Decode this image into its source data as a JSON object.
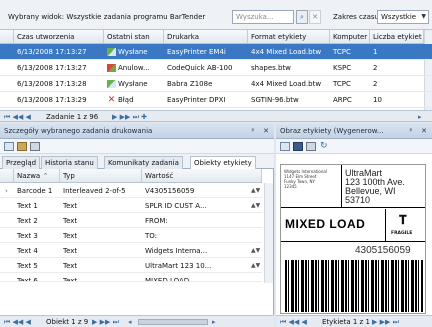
{
  "filter": {
    "label": "Wybrany widok: Wszystkie zadania programu BarTender",
    "search_placeholder": "Wyszuka...",
    "zakres_label": "Zakres czasu:",
    "zakres_value": "Wszystkie"
  },
  "jobs": {
    "columns": [
      "Czas utworzenia",
      "Ostatni stan",
      "Drukarka",
      "Format etykiety",
      "Komputer",
      "Liczba etykiet"
    ],
    "rows": [
      {
        "time": "6/13/2008 17:13:27",
        "status": "Wysłane",
        "status_icon": "sent-icon",
        "printer": "EasyPrinter EM4i",
        "format": "4x4 Mixed Load.btw",
        "computer": "TCPC",
        "count": "1",
        "selected": true
      },
      {
        "time": "6/13/2008 17:13:27",
        "status": "Anulow...",
        "status_icon": "cancel-icon",
        "printer": "CodeQuick AB-100",
        "format": "shapes.btw",
        "computer": "KSPC",
        "count": "2",
        "selected": false
      },
      {
        "time": "6/13/2008 17:13:28",
        "status": "Wysłane",
        "status_icon": "sent-icon",
        "printer": "Babra Z108e",
        "format": "4x4 Mixed Load.btw",
        "computer": "TCPC",
        "count": "2",
        "selected": false
      },
      {
        "time": "6/13/2008 17:13:29",
        "status": "Błąd",
        "status_icon": "error-icon",
        "printer": "EasyPrinter DPXI",
        "format": "SGTIN-96.btw",
        "computer": "ARPC",
        "count": "10",
        "selected": false
      }
    ],
    "pager": {
      "text": "Zadanie 1 z 96"
    }
  },
  "details": {
    "title": "Szczegóły wybranego zadania drukowania",
    "tabs": [
      "Przegląd",
      "Historia stanu",
      "Komunikaty zadania",
      "Obiekty etykiety"
    ],
    "columns": [
      "Nazwa",
      "Typ",
      "Wartość"
    ],
    "rows": [
      {
        "name": "Barcode 1",
        "type": "Interleaved 2-of-5",
        "value": "V4305156059"
      },
      {
        "name": "Text 1",
        "type": "Text",
        "value": "SPLR ID CUST A..."
      },
      {
        "name": "Text 2",
        "type": "Text",
        "value": "FROM:"
      },
      {
        "name": "Text 3",
        "type": "Text",
        "value": "TO:"
      },
      {
        "name": "Text 4",
        "type": "Text",
        "value": "Widgets Interna..."
      },
      {
        "name": "Text 5",
        "type": "Text",
        "value": "UltraMart 123 10..."
      },
      {
        "name": "Text 6",
        "type": "Text",
        "value": "MIXED LOAD"
      }
    ],
    "pager": {
      "text": "Obiekt 1 z 9"
    }
  },
  "preview": {
    "title": "Obraz etykiety (Wygenerow...",
    "from_text": "Widgets International\n1147 Elm Street\nFunky Town, NY\n12345",
    "to_name": "UltraMart",
    "to_addr1": "123 100th Ave.",
    "to_addr2": "Bellevue, WI",
    "to_zip": "53710",
    "mixed_load": "MIXED LOAD",
    "fragile": "FRAGILE",
    "barcode_text": "4305156059",
    "pager": {
      "text": "Etykieta 1 z 1"
    }
  }
}
